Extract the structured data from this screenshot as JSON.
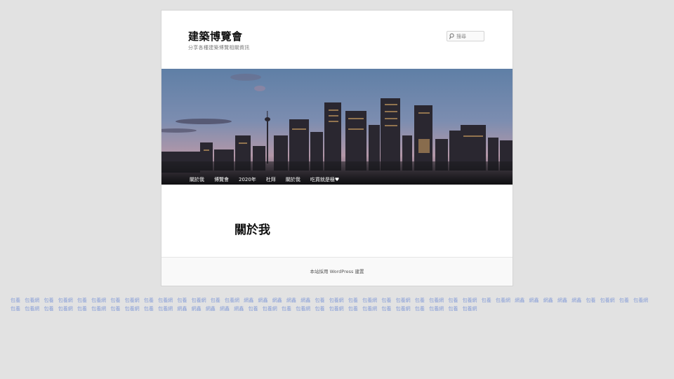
{
  "site": {
    "title": "建築博覽會",
    "description": "分享各種建築博覽相關資訊"
  },
  "search": {
    "placeholder": "搜尋",
    "icon": "search-icon"
  },
  "nav": {
    "items": [
      {
        "label": "關於我"
      },
      {
        "label": "博覽會"
      },
      {
        "label": "2020年"
      },
      {
        "label": "杜拜"
      },
      {
        "label": "關於我"
      },
      {
        "label": "吃貨就是極♥"
      }
    ]
  },
  "page": {
    "title": "關於我"
  },
  "footer": {
    "prefix": "本站採用 ",
    "wp_link": "WordPress",
    "suffix": " 建置"
  },
  "spam_links": [
    "包養",
    "包養網",
    "包養",
    "包養網",
    "包養",
    "包養網",
    "包養",
    "包養網",
    "包養",
    "包養網",
    "包養",
    "包養網",
    "包養",
    "包養網",
    "網鑫",
    "網鑫",
    "網鑫",
    "網鑫",
    "網鑫",
    "包養",
    "包養網",
    "包養",
    "包養網",
    "包養",
    "包養網",
    "包養",
    "包養網",
    "包養",
    "包養網",
    "包養",
    "包養網",
    "網鑫",
    "網鑫",
    "網鑫",
    "網鑫",
    "網鑫",
    "包養",
    "包養網",
    "包養",
    "包養網",
    "包養",
    "包養網",
    "包養",
    "包養網",
    "包養",
    "包養網",
    "包養",
    "包養網",
    "包養",
    "包養網",
    "網鑫",
    "網鑫",
    "網鑫",
    "網鑫",
    "網鑫",
    "包養",
    "包養網",
    "包養",
    "包養網",
    "包養",
    "包養網",
    "包養",
    "包養網",
    "包養",
    "包養網",
    "包養",
    "包養網",
    "包養",
    "包養網"
  ]
}
